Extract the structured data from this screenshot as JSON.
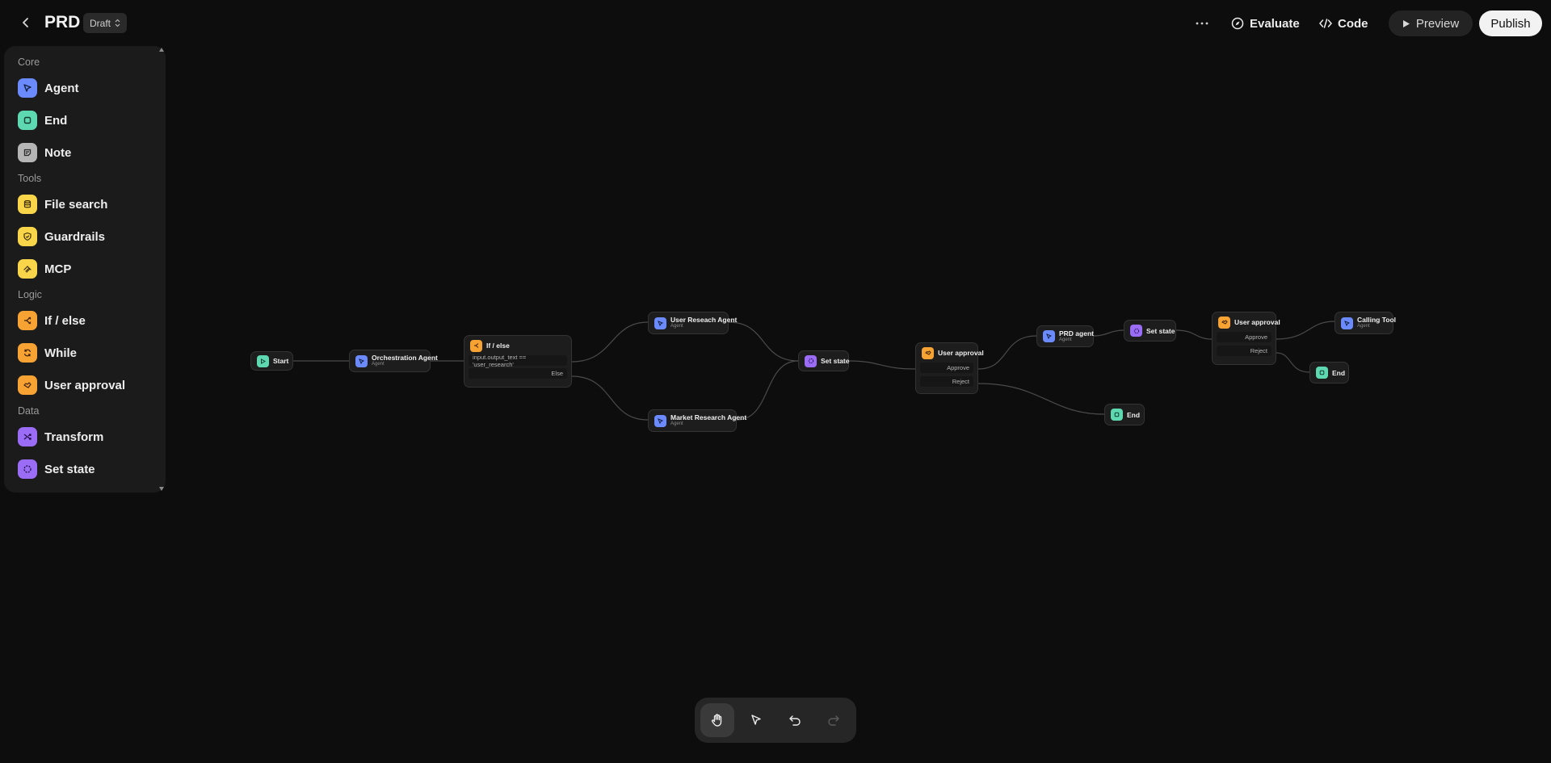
{
  "header": {
    "title": "PRD",
    "status": "Draft",
    "evaluate_label": "Evaluate",
    "code_label": "Code",
    "preview_label": "Preview",
    "publish_label": "Publish"
  },
  "sidebar": {
    "sections": [
      {
        "label": "Core",
        "items": [
          {
            "label": "Agent",
            "icon": "agent-icon",
            "color": "#6b8afd"
          },
          {
            "label": "End",
            "icon": "end-icon",
            "color": "#5ed8b0"
          },
          {
            "label": "Note",
            "icon": "note-icon",
            "color": "#b5b5b5"
          }
        ]
      },
      {
        "label": "Tools",
        "items": [
          {
            "label": "File search",
            "icon": "file-search-icon",
            "color": "#f9d54a"
          },
          {
            "label": "Guardrails",
            "icon": "guardrails-icon",
            "color": "#f9d54a"
          },
          {
            "label": "MCP",
            "icon": "mcp-icon",
            "color": "#f9d54a"
          }
        ]
      },
      {
        "label": "Logic",
        "items": [
          {
            "label": "If / else",
            "icon": "if-else-icon",
            "color": "#f7a334"
          },
          {
            "label": "While",
            "icon": "while-icon",
            "color": "#f7a334"
          },
          {
            "label": "User approval",
            "icon": "user-approval-icon",
            "color": "#f7a334"
          }
        ]
      },
      {
        "label": "Data",
        "items": [
          {
            "label": "Transform",
            "icon": "transform-icon",
            "color": "#9b6cf6"
          },
          {
            "label": "Set state",
            "icon": "set-state-icon",
            "color": "#9b6cf6"
          }
        ]
      }
    ]
  },
  "canvas": {
    "nodes": {
      "start": {
        "label": "Start"
      },
      "orchestration": {
        "label": "Orchestration Agent",
        "sub": "Agent"
      },
      "ifelse": {
        "label": "If / else",
        "condition": "input.output_text == 'user_research'",
        "else": "Else"
      },
      "user_research": {
        "label": "User Reseach Agent",
        "sub": "Agent"
      },
      "market_research": {
        "label": "Market Research Agent",
        "sub": "Agent"
      },
      "set_state_1": {
        "label": "Set state"
      },
      "approval_1": {
        "label": "User approval",
        "approve": "Approve",
        "reject": "Reject"
      },
      "prd_agent": {
        "label": "PRD agent",
        "sub": "Agent"
      },
      "set_state_2": {
        "label": "Set state"
      },
      "end_1": {
        "label": "End"
      },
      "approval_2": {
        "label": "User approval",
        "approve": "Approve",
        "reject": "Reject"
      },
      "calling_tool": {
        "label": "Calling Tool",
        "sub": "Agent"
      },
      "end_2": {
        "label": "End"
      }
    }
  },
  "toolbar": {
    "tools": [
      "hand-icon",
      "pointer-icon",
      "undo-icon",
      "redo-icon"
    ],
    "active": "hand-icon"
  }
}
